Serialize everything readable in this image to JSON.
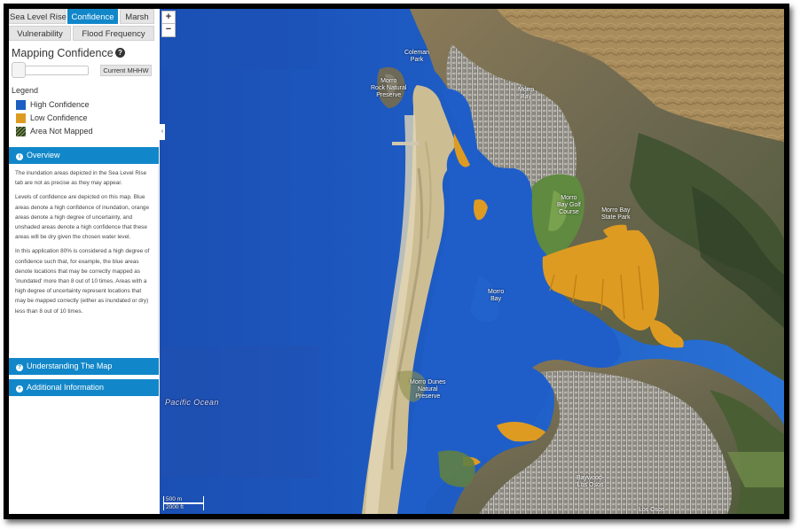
{
  "tabs": [
    {
      "label": "Sea Level Rise",
      "active": false
    },
    {
      "label": "Confidence",
      "active": true
    },
    {
      "label": "Marsh",
      "active": false
    },
    {
      "label": "Vulnerability",
      "active": false
    },
    {
      "label": "Flood Frequency",
      "active": false
    }
  ],
  "panel": {
    "title": "Mapping Confidence",
    "help_icon": "question-circle-icon",
    "slider_button": "Current MHHW",
    "slider_value_fraction": 0
  },
  "legend": {
    "title": "Legend",
    "items": [
      {
        "label": "High Confidence",
        "color": "#1c5ec1"
      },
      {
        "label": "Low Confidence",
        "color": "#de9b22"
      },
      {
        "label": "Area Not Mapped",
        "pattern": "hatch"
      }
    ]
  },
  "sections": {
    "overview": {
      "label": "Overview",
      "icon": "info-circle-icon",
      "paragraphs": [
        "The inundation areas depicted in the Sea Level Rise tab are not as precise as they may appear.",
        "Levels of confidence are depicted on this map. Blue areas denote a high confidence of inundation, orange areas denote a high degree of uncertainty, and unshaded areas denote a high confidence that these areas will be dry given the chosen water level.",
        "In this application 80% is considered a high degree of confidence such that, for example, the blue areas denote locations that may be correctly mapped as 'inundated' more than 8 out of 10 times. Areas with a high degree of uncertainty represent locations that may be mapped correctly (either as inundated or dry) less than 8 out of 10 times."
      ]
    },
    "understanding": {
      "label": "Understanding The Map",
      "icon": "question-circle-icon"
    },
    "additional": {
      "label": "Additional Information",
      "icon": "plus-circle-icon"
    }
  },
  "map": {
    "zoom_in": "+",
    "zoom_out": "−",
    "ocean_label": "Pacific   Ocean",
    "place_labels": {
      "morro_bay_town": "Morro\nBay",
      "morro_rock": "Morro\nRock Natural\nPreserve",
      "coleman_park": "Coleman\nPark",
      "golf_course": "Morro\nBay Golf\nCourse",
      "state_park": "Morro Bay\nState Park",
      "bay": "Morro\nBay",
      "dunes": "Morro Dunes\nNatural\nPreserve",
      "baywood": "Baywood-\nLos Osos",
      "los_osos": "Los Osos"
    },
    "scale": {
      "top": "500 m",
      "bottom": "2000 ft"
    },
    "collapse_icon": "chevron-left-icon"
  }
}
